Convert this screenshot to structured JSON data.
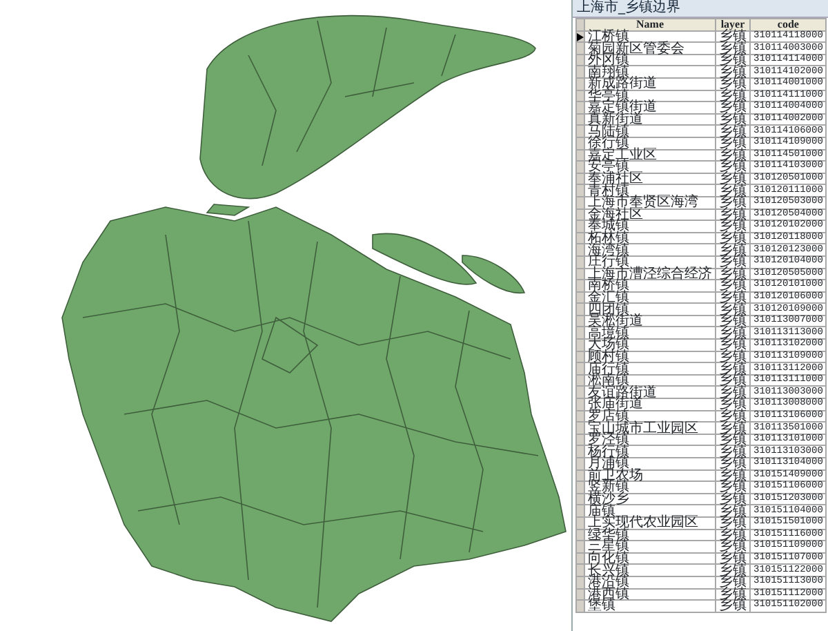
{
  "window": {
    "title": "上海市_乡镇边界"
  },
  "table": {
    "columns": [
      "Name",
      "layer",
      "code"
    ],
    "rows": [
      {
        "name": "江桥镇",
        "layer": "乡镇",
        "code": "310114118000",
        "selected": true
      },
      {
        "name": "菊园新区管委会",
        "layer": "乡镇",
        "code": "310114003000",
        "selected": false
      },
      {
        "name": "外冈镇",
        "layer": "乡镇",
        "code": "310114114000",
        "selected": false
      },
      {
        "name": "南翔镇",
        "layer": "乡镇",
        "code": "310114102000",
        "selected": false
      },
      {
        "name": "新成路街道",
        "layer": "乡镇",
        "code": "310114001000",
        "selected": false
      },
      {
        "name": "华亭镇",
        "layer": "乡镇",
        "code": "310114111000",
        "selected": false
      },
      {
        "name": "嘉定镇街道",
        "layer": "乡镇",
        "code": "310114004000",
        "selected": false
      },
      {
        "name": "真新街道",
        "layer": "乡镇",
        "code": "310114002000",
        "selected": false
      },
      {
        "name": "马陆镇",
        "layer": "乡镇",
        "code": "310114106000",
        "selected": false
      },
      {
        "name": "徐行镇",
        "layer": "乡镇",
        "code": "310114109000",
        "selected": false
      },
      {
        "name": "嘉定工业区",
        "layer": "乡镇",
        "code": "310114501000",
        "selected": false
      },
      {
        "name": "安亭镇",
        "layer": "乡镇",
        "code": "310114103000",
        "selected": false
      },
      {
        "name": "奉浦社区",
        "layer": "乡镇",
        "code": "310120501000",
        "selected": false
      },
      {
        "name": "青村镇",
        "layer": "乡镇",
        "code": "310120111000",
        "selected": false
      },
      {
        "name": "上海市奉贤区海湾",
        "layer": "乡镇",
        "code": "310120503000",
        "selected": false
      },
      {
        "name": "金海社区",
        "layer": "乡镇",
        "code": "310120504000",
        "selected": false
      },
      {
        "name": "奉城镇",
        "layer": "乡镇",
        "code": "310120102000",
        "selected": false
      },
      {
        "name": "柘林镇",
        "layer": "乡镇",
        "code": "310120118000",
        "selected": false
      },
      {
        "name": "海湾镇",
        "layer": "乡镇",
        "code": "310120123000",
        "selected": false
      },
      {
        "name": "庄行镇",
        "layer": "乡镇",
        "code": "310120104000",
        "selected": false
      },
      {
        "name": "上海市漕泾综合经济",
        "layer": "乡镇",
        "code": "310120505000",
        "selected": false
      },
      {
        "name": "南桥镇",
        "layer": "乡镇",
        "code": "310120101000",
        "selected": false
      },
      {
        "name": "金汇镇",
        "layer": "乡镇",
        "code": "310120106000",
        "selected": false
      },
      {
        "name": "四团镇",
        "layer": "乡镇",
        "code": "310120109000",
        "selected": false
      },
      {
        "name": "吴淞街道",
        "layer": "乡镇",
        "code": "310113007000",
        "selected": false
      },
      {
        "name": "高境镇",
        "layer": "乡镇",
        "code": "310113113000",
        "selected": false
      },
      {
        "name": "大场镇",
        "layer": "乡镇",
        "code": "310113102000",
        "selected": false
      },
      {
        "name": "顾村镇",
        "layer": "乡镇",
        "code": "310113109000",
        "selected": false
      },
      {
        "name": "庙行镇",
        "layer": "乡镇",
        "code": "310113112000",
        "selected": false
      },
      {
        "name": "淞南镇",
        "layer": "乡镇",
        "code": "310113111000",
        "selected": false
      },
      {
        "name": "友谊路街道",
        "layer": "乡镇",
        "code": "310113003000",
        "selected": false
      },
      {
        "name": "张庙街道",
        "layer": "乡镇",
        "code": "310113008000",
        "selected": false
      },
      {
        "name": "罗店镇",
        "layer": "乡镇",
        "code": "310113106000",
        "selected": false
      },
      {
        "name": "宝山城市工业园区",
        "layer": "乡镇",
        "code": "310113501000",
        "selected": false
      },
      {
        "name": "罗泾镇",
        "layer": "乡镇",
        "code": "310113101000",
        "selected": false
      },
      {
        "name": "杨行镇",
        "layer": "乡镇",
        "code": "310113103000",
        "selected": false
      },
      {
        "name": "月浦镇",
        "layer": "乡镇",
        "code": "310113104000",
        "selected": false
      },
      {
        "name": "前卫农场",
        "layer": "乡镇",
        "code": "310151409000",
        "selected": false
      },
      {
        "name": "竖新镇",
        "layer": "乡镇",
        "code": "310151106000",
        "selected": false
      },
      {
        "name": "横沙乡",
        "layer": "乡镇",
        "code": "310151203000",
        "selected": false
      },
      {
        "name": "庙镇",
        "layer": "乡镇",
        "code": "310151104000",
        "selected": false
      },
      {
        "name": "上实现代农业园区",
        "layer": "乡镇",
        "code": "310151501000",
        "selected": false
      },
      {
        "name": "绿华镇",
        "layer": "乡镇",
        "code": "310151116000",
        "selected": false
      },
      {
        "name": "三星镇",
        "layer": "乡镇",
        "code": "310151109000",
        "selected": false
      },
      {
        "name": "向化镇",
        "layer": "乡镇",
        "code": "310151107000",
        "selected": false
      },
      {
        "name": "长兴镇",
        "layer": "乡镇",
        "code": "310151122000",
        "selected": false
      },
      {
        "name": "港沿镇",
        "layer": "乡镇",
        "code": "310151113000",
        "selected": false
      },
      {
        "name": "港西镇",
        "layer": "乡镇",
        "code": "310151112000",
        "selected": false
      },
      {
        "name": "堡镇",
        "layer": "乡镇",
        "code": "310151102000",
        "selected": false
      }
    ]
  }
}
